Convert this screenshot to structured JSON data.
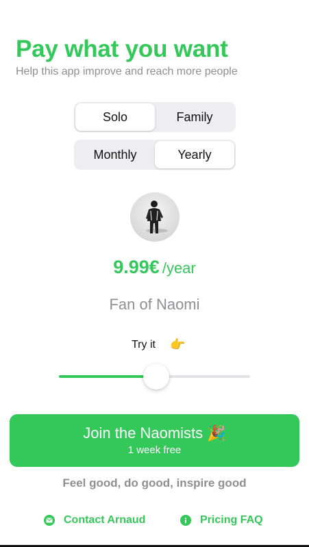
{
  "header": {
    "title": "Pay what you want",
    "subtitle": "Help this app improve and reach more people"
  },
  "plan_selector": {
    "options": [
      "Solo",
      "Family"
    ],
    "selected": "Solo"
  },
  "billing_selector": {
    "options": [
      "Monthly",
      "Yearly"
    ],
    "selected": "Yearly"
  },
  "avatar": {
    "icon": "developer-photo"
  },
  "price": {
    "amount": "9.99€",
    "period": "/year"
  },
  "tier_name": "Fan of Naomi",
  "slider": {
    "label": "Try it",
    "hint_icon": "pointing-right-hand-emoji",
    "hint_glyph": "👉",
    "value": 0.51
  },
  "join_button": {
    "title": "Join the Naomists",
    "title_icon": "party-popper-emoji",
    "title_glyph": "🎉",
    "subtitle": "1 week free"
  },
  "tagline": "Feel good, do good, inspire good",
  "footer_links": {
    "contact": {
      "label": "Contact Arnaud",
      "icon": "envelope-icon"
    },
    "faq": {
      "label": "Pricing FAQ",
      "icon": "info-icon"
    }
  },
  "colors": {
    "accent": "#34c759",
    "secondary_text": "#8e8e93"
  }
}
